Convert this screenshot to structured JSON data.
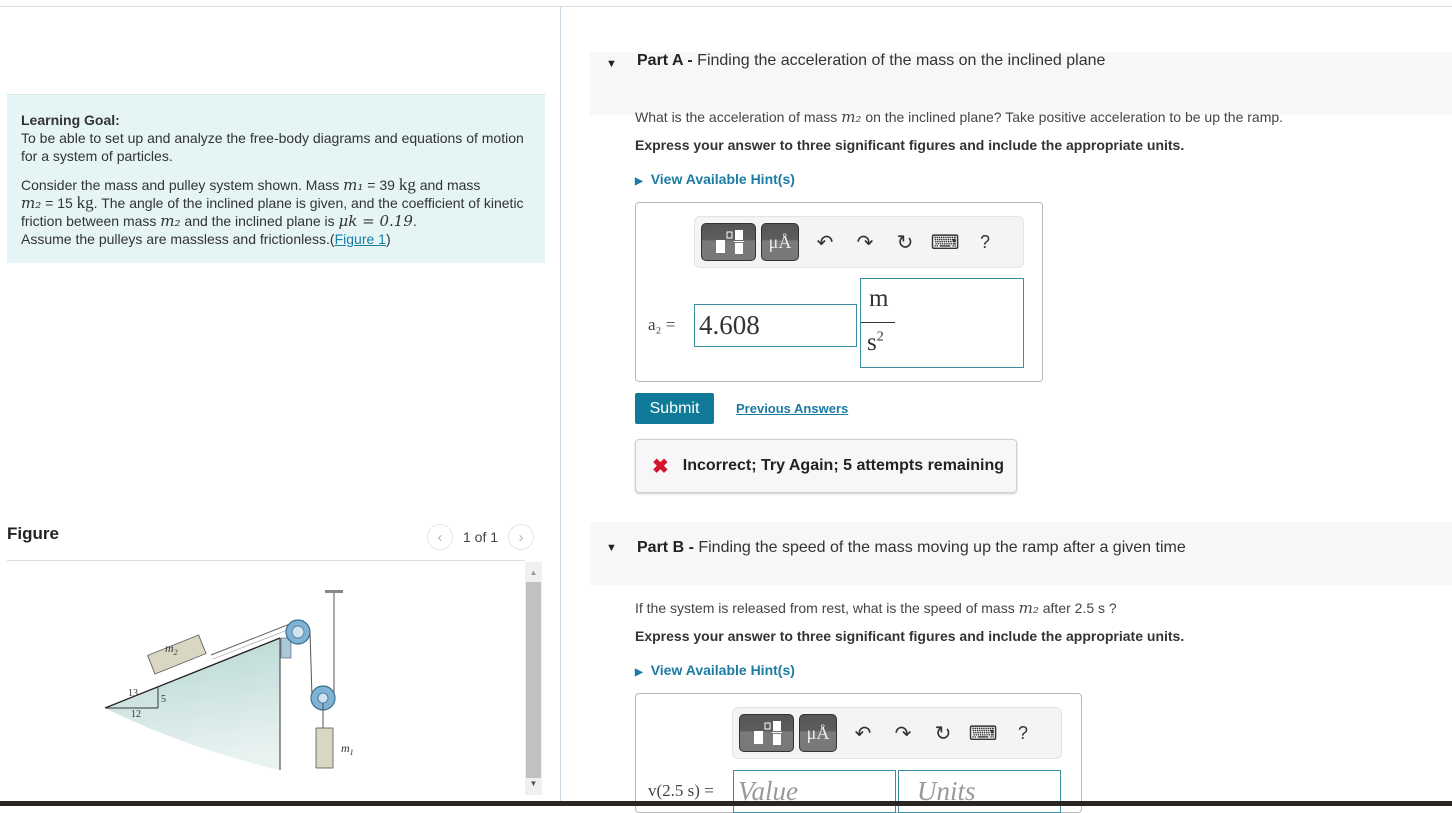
{
  "learning_goal": {
    "title": "Learning Goal:",
    "description": "To be able to set up and analyze the free-body diagrams and equations of motion for a system of particles.",
    "problem": {
      "t1": "Consider the mass and pulley system shown. Mass ",
      "m1": "m₁",
      "t2": " = 39 ",
      "kg": "kg",
      "t3": " and mass",
      "m2": "m₂",
      "t4": " = 15 ",
      "t5": ". The angle of the inclined plane is given, and the coefficient of kinetic friction between mass ",
      "t6": " and the inclined plane is ",
      "mu": "μk = 0.19",
      "t7": ".",
      "t8": "Assume the pulleys are massless and frictionless.",
      "fig_link": "Figure 1",
      "paren_open": "(",
      "paren_close": ")"
    }
  },
  "figure": {
    "title": "Figure",
    "prev_icon": "‹",
    "next_icon": "›",
    "count": "1 of 1",
    "labels": {
      "m2": "m",
      "m2_sub": "2",
      "m1": "m",
      "m1_sub": "1",
      "hyp": "13",
      "rise": "5",
      "run": "12"
    },
    "scroll_up": "▲",
    "scroll_down": "▼"
  },
  "partA": {
    "label": "Part A -",
    "title": " Finding the acceleration of  the mass on the inclined plane",
    "question_pre": "What is the acceleration of mass ",
    "question_var": "m₂",
    "question_post": " on the inclined plane? Take positive acceleration to be up the ramp.",
    "instruction": "Express your answer to three significant figures and include the appropriate units.",
    "hint": "View Available Hint(s)",
    "var_label": "a₂ =",
    "value": "4.608",
    "unit_num": "m",
    "unit_den": "s",
    "unit_exp": "2",
    "submit": "Submit",
    "previous_answers": "Previous Answers",
    "feedback_icon": "✖",
    "feedback": "Incorrect; Try Again; 5 attempts remaining"
  },
  "partB": {
    "label": "Part B -",
    "title": " Finding the speed of the mass moving up the ramp after a given time",
    "question_pre": "If the system is released from rest, what is the speed of mass ",
    "question_var": "m₂",
    "question_post": " after 2.5  s ?",
    "instruction": "Express your answer to three significant figures and include the appropriate units.",
    "hint": "View Available Hint(s)",
    "var_label": "v(2.5 s) =",
    "value_placeholder": "Value",
    "units_placeholder": "Units"
  },
  "toolbar": {
    "templates_icon": "templates-icon",
    "units_label": "μÅ",
    "undo": "↶",
    "redo": "↷",
    "reset": "↻",
    "keyboard": "⌨",
    "help": "?"
  },
  "colors": {
    "accent": "#0f7b99",
    "link": "#1a7ba3",
    "error": "#d1162e",
    "goal_bg": "#e5f4f5"
  }
}
